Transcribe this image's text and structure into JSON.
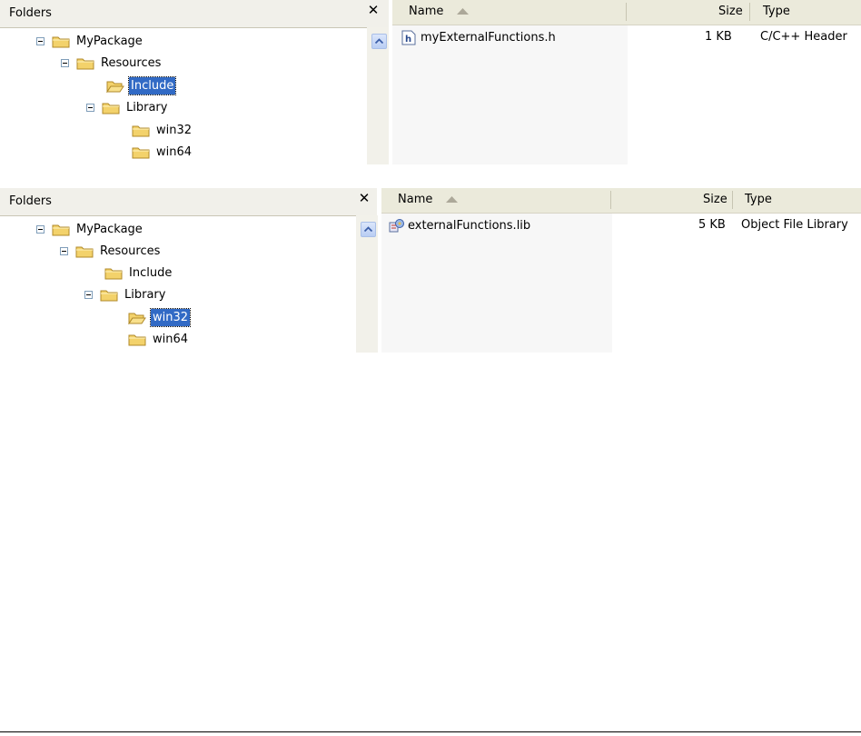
{
  "panels": [
    {
      "folders_title": "Folders",
      "close_glyph": "✕",
      "tree": [
        {
          "label": "MyPackage",
          "expander": "minus"
        },
        {
          "label": "Resources",
          "expander": "minus"
        },
        {
          "label": "Include",
          "expander": "none",
          "selected": true
        },
        {
          "label": "Library",
          "expander": "minus"
        },
        {
          "label": "win32",
          "expander": "none"
        },
        {
          "label": "win64",
          "expander": "none"
        }
      ],
      "columns": {
        "name": "Name",
        "size": "Size",
        "type": "Type"
      },
      "files": [
        {
          "name": "myExternalFunctions.h",
          "size": "1 KB",
          "type": "C/C++ Header",
          "icon": "header-file-icon"
        }
      ]
    },
    {
      "folders_title": "Folders",
      "close_glyph": "✕",
      "tree": [
        {
          "label": "MyPackage",
          "expander": "minus"
        },
        {
          "label": "Resources",
          "expander": "minus"
        },
        {
          "label": "Include",
          "expander": "none"
        },
        {
          "label": "Library",
          "expander": "minus"
        },
        {
          "label": "win32",
          "expander": "none",
          "selected": true
        },
        {
          "label": "win64",
          "expander": "none"
        }
      ],
      "columns": {
        "name": "Name",
        "size": "Size",
        "type": "Type"
      },
      "files": [
        {
          "name": "externalFunctions.lib",
          "size": "5 KB",
          "type": "Object File Library",
          "icon": "library-file-icon"
        }
      ]
    }
  ],
  "colors": {
    "selection": "#316ac5",
    "folder": "#f3d26b",
    "header": "#ebeadb"
  }
}
